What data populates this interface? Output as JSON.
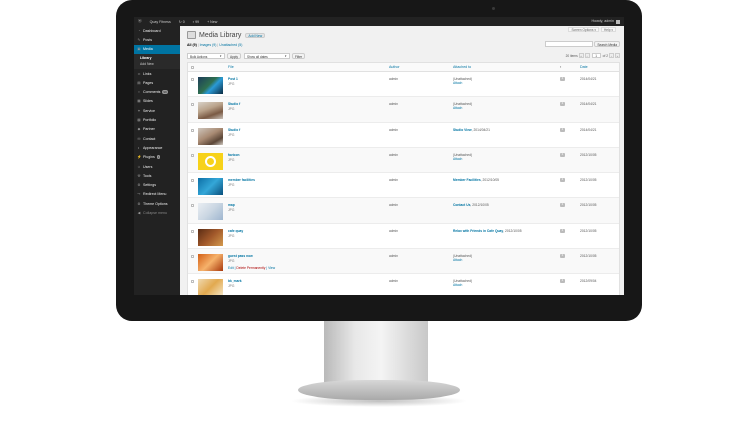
{
  "admin_bar": {
    "site_name": "Quay Fitness",
    "updates_count": "0",
    "comments_count": "99",
    "new_label": "New",
    "greeting": "Howdy, admin"
  },
  "sidebar": {
    "items": [
      {
        "label": "Dashboard",
        "icon": "dashboard-icon"
      },
      {
        "label": "Posts",
        "icon": "pin-icon"
      },
      {
        "label": "Media",
        "icon": "media-icon"
      },
      {
        "label": "Links",
        "icon": "link-icon"
      },
      {
        "label": "Pages",
        "icon": "page-icon"
      },
      {
        "label": "Comments",
        "icon": "comment-icon",
        "badge": "99"
      },
      {
        "label": "Slides",
        "icon": "slides-icon"
      },
      {
        "label": "Service",
        "icon": "service-icon"
      },
      {
        "label": "Portfolio",
        "icon": "portfolio-icon"
      },
      {
        "label": "Partner",
        "icon": "partner-icon"
      },
      {
        "label": "Contact",
        "icon": "contact-icon"
      },
      {
        "label": "Appearance",
        "icon": "appearance-icon"
      },
      {
        "label": "Plugins",
        "icon": "plugin-icon",
        "badge": "1"
      },
      {
        "label": "Users",
        "icon": "users-icon"
      },
      {
        "label": "Tools",
        "icon": "tools-icon"
      },
      {
        "label": "Settings",
        "icon": "settings-icon"
      },
      {
        "label": "Redirect Menu",
        "icon": "redirect-icon"
      },
      {
        "label": "Theme Options",
        "icon": "theme-options-icon"
      },
      {
        "label": "Collapse menu",
        "icon": "collapse-icon"
      }
    ],
    "media_submenu": [
      "Library",
      "Add New"
    ]
  },
  "header": {
    "screen_options": "Screen Options",
    "help": "Help",
    "title": "Media Library",
    "add_new": "Add New"
  },
  "filters": {
    "all": "All",
    "all_count": "(9)",
    "images": "Images",
    "images_count": "(9)",
    "unattached": "Unattached",
    "unattached_count": "(5)"
  },
  "search": {
    "button": "Search Media",
    "value": ""
  },
  "toolbar": {
    "bulk_actions": "Bulk Actions",
    "apply": "Apply",
    "all_dates": "Show all dates",
    "filter": "Filter"
  },
  "pagination": {
    "items": "20 items",
    "first": "«",
    "prev": "‹",
    "current_page": "1",
    "of_label": "of 2",
    "next": "›",
    "last": "»"
  },
  "table": {
    "columns": {
      "file": "File",
      "author": "Author",
      "attached_to": "Attached to",
      "date": "Date"
    },
    "rows": [
      {
        "name": "Post 1",
        "type": "JPG",
        "author": "admin",
        "attached": "(Unattached)",
        "attach_link": "Attach",
        "attached_date": "",
        "comments": "0",
        "date": "2014/04/21",
        "thumb": "t-post"
      },
      {
        "name": "Studio f",
        "type": "JPG",
        "author": "admin",
        "attached": "(Unattached)",
        "attach_link": "Attach",
        "attached_date": "",
        "comments": "0",
        "date": "2014/04/21",
        "thumb": "t-studio"
      },
      {
        "name": "Studio f",
        "type": "JPG",
        "author": "admin",
        "attached": "Studio View",
        "attach_link": "",
        "attached_date": "2014/04/21",
        "comments": "0",
        "date": "2014/04/21",
        "thumb": "t-studio2"
      },
      {
        "name": "favicon",
        "type": "JPG",
        "author": "admin",
        "attached": "(Unattached)",
        "attach_link": "Attach",
        "attached_date": "",
        "comments": "0",
        "date": "2012/10/05",
        "thumb": "t-favicon"
      },
      {
        "name": "member facilities",
        "type": "JPG",
        "author": "admin",
        "attached": "Member Facilities",
        "attach_link": "",
        "attached_date": "2012/10/05",
        "comments": "0",
        "date": "2012/10/05",
        "thumb": "t-member"
      },
      {
        "name": "map",
        "type": "JPG",
        "author": "admin",
        "attached": "Contact Us",
        "attach_link": "",
        "attached_date": "2012/10/05",
        "comments": "0",
        "date": "2012/10/05",
        "thumb": "t-map"
      },
      {
        "name": "cafe quay",
        "type": "JPG",
        "author": "admin",
        "attached": "Relax with Friends in Cafe Quay",
        "attach_link": "",
        "attached_date": "2012/10/05",
        "comments": "0",
        "date": "2012/10/05",
        "thumb": "t-cafe"
      },
      {
        "name": "guest pass now",
        "type": "JPG",
        "author": "admin",
        "attached": "(Unattached)",
        "attach_link": "Attach",
        "attached_date": "",
        "comments": "0",
        "date": "2012/10/05",
        "thumb": "t-press",
        "row_actions": [
          "Edit",
          "Delete Permanently",
          "View"
        ]
      },
      {
        "name": "bk_mark",
        "type": "JPG",
        "author": "admin",
        "attached": "(Unattached)",
        "attach_link": "Attach",
        "attached_date": "",
        "comments": "0",
        "date": "2012/09/04",
        "thumb": "t-mark"
      }
    ]
  }
}
